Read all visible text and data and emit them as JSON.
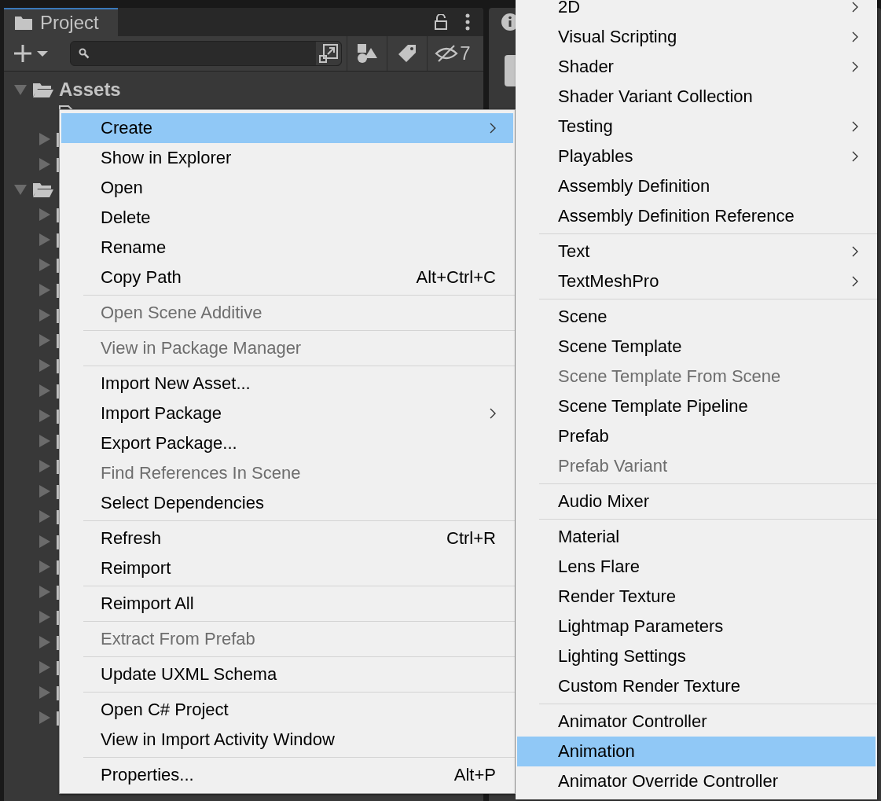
{
  "project_panel": {
    "tab": {
      "label": "Project",
      "selected": true
    },
    "hidden_count": "7",
    "tree": [
      {
        "label": "Assets",
        "kind": "folder",
        "expanded": true,
        "children": [
          {
            "kind": "file"
          },
          {
            "kind": "folder",
            "expanded": false
          },
          {
            "kind": "folder",
            "expanded": false
          }
        ]
      },
      {
        "kind": "folder",
        "expanded": true,
        "children": [
          {
            "kind": "folder",
            "expanded": false
          },
          {
            "kind": "folder",
            "expanded": false
          },
          {
            "kind": "folder",
            "expanded": false
          },
          {
            "kind": "folder",
            "expanded": false
          },
          {
            "kind": "folder",
            "expanded": false
          },
          {
            "kind": "folder",
            "expanded": false
          },
          {
            "kind": "folder",
            "expanded": false
          },
          {
            "kind": "folder",
            "expanded": false
          },
          {
            "kind": "folder",
            "expanded": false
          },
          {
            "kind": "folder",
            "expanded": false
          },
          {
            "kind": "folder",
            "expanded": false
          },
          {
            "kind": "folder",
            "expanded": false
          },
          {
            "kind": "folder",
            "expanded": false
          },
          {
            "kind": "folder",
            "expanded": false
          },
          {
            "kind": "folder",
            "expanded": false
          },
          {
            "kind": "folder",
            "expanded": false
          },
          {
            "kind": "folder",
            "expanded": false
          },
          {
            "kind": "folder",
            "expanded": false
          },
          {
            "kind": "folder",
            "expanded": false
          },
          {
            "kind": "folder",
            "expanded": false
          },
          {
            "kind": "folder",
            "expanded": false
          }
        ]
      }
    ]
  },
  "context_menu": [
    {
      "kind": "item",
      "label": "Create",
      "submenu": true,
      "selected": true,
      "disabled": false
    },
    {
      "kind": "item",
      "label": "Show in Explorer",
      "selected": false,
      "disabled": false
    },
    {
      "kind": "item",
      "label": "Open",
      "selected": false,
      "disabled": false
    },
    {
      "kind": "item",
      "label": "Delete",
      "selected": false,
      "disabled": false
    },
    {
      "kind": "item",
      "label": "Rename",
      "selected": false,
      "disabled": false
    },
    {
      "kind": "item",
      "label": "Copy Path",
      "shortcut": "Alt+Ctrl+C",
      "selected": false,
      "disabled": false
    },
    {
      "kind": "separator"
    },
    {
      "kind": "item",
      "label": "Open Scene Additive",
      "selected": false,
      "disabled": true
    },
    {
      "kind": "separator"
    },
    {
      "kind": "item",
      "label": "View in Package Manager",
      "selected": false,
      "disabled": true
    },
    {
      "kind": "separator"
    },
    {
      "kind": "item",
      "label": "Import New Asset...",
      "selected": false,
      "disabled": false
    },
    {
      "kind": "item",
      "label": "Import Package",
      "submenu": true,
      "selected": false,
      "disabled": false
    },
    {
      "kind": "item",
      "label": "Export Package...",
      "selected": false,
      "disabled": false
    },
    {
      "kind": "item",
      "label": "Find References In Scene",
      "selected": false,
      "disabled": true
    },
    {
      "kind": "item",
      "label": "Select Dependencies",
      "selected": false,
      "disabled": false
    },
    {
      "kind": "separator"
    },
    {
      "kind": "item",
      "label": "Refresh",
      "shortcut": "Ctrl+R",
      "selected": false,
      "disabled": false
    },
    {
      "kind": "item",
      "label": "Reimport",
      "selected": false,
      "disabled": false
    },
    {
      "kind": "separator"
    },
    {
      "kind": "item",
      "label": "Reimport All",
      "selected": false,
      "disabled": false
    },
    {
      "kind": "separator"
    },
    {
      "kind": "item",
      "label": "Extract From Prefab",
      "selected": false,
      "disabled": true
    },
    {
      "kind": "separator"
    },
    {
      "kind": "item",
      "label": "Update UXML Schema",
      "selected": false,
      "disabled": false
    },
    {
      "kind": "separator"
    },
    {
      "kind": "item",
      "label": "Open C# Project",
      "selected": false,
      "disabled": false
    },
    {
      "kind": "item",
      "label": "View in Import Activity Window",
      "selected": false,
      "disabled": false
    },
    {
      "kind": "separator"
    },
    {
      "kind": "item",
      "label": "Properties...",
      "shortcut": "Alt+P",
      "selected": false,
      "disabled": false
    }
  ],
  "create_submenu": [
    {
      "kind": "item",
      "label": "2D",
      "submenu": true,
      "selected": false,
      "disabled": false
    },
    {
      "kind": "item",
      "label": "Visual Scripting",
      "submenu": true,
      "selected": false,
      "disabled": false
    },
    {
      "kind": "item",
      "label": "Shader",
      "submenu": true,
      "selected": false,
      "disabled": false
    },
    {
      "kind": "item",
      "label": "Shader Variant Collection",
      "selected": false,
      "disabled": false
    },
    {
      "kind": "item",
      "label": "Testing",
      "submenu": true,
      "selected": false,
      "disabled": false
    },
    {
      "kind": "item",
      "label": "Playables",
      "submenu": true,
      "selected": false,
      "disabled": false
    },
    {
      "kind": "item",
      "label": "Assembly Definition",
      "selected": false,
      "disabled": false
    },
    {
      "kind": "item",
      "label": "Assembly Definition Reference",
      "selected": false,
      "disabled": false
    },
    {
      "kind": "separator"
    },
    {
      "kind": "item",
      "label": "Text",
      "submenu": true,
      "selected": false,
      "disabled": false
    },
    {
      "kind": "item",
      "label": "TextMeshPro",
      "submenu": true,
      "selected": false,
      "disabled": false
    },
    {
      "kind": "separator"
    },
    {
      "kind": "item",
      "label": "Scene",
      "selected": false,
      "disabled": false
    },
    {
      "kind": "item",
      "label": "Scene Template",
      "selected": false,
      "disabled": false
    },
    {
      "kind": "item",
      "label": "Scene Template From Scene",
      "selected": false,
      "disabled": true
    },
    {
      "kind": "item",
      "label": "Scene Template Pipeline",
      "selected": false,
      "disabled": false
    },
    {
      "kind": "item",
      "label": "Prefab",
      "selected": false,
      "disabled": false
    },
    {
      "kind": "item",
      "label": "Prefab Variant",
      "selected": false,
      "disabled": true
    },
    {
      "kind": "separator"
    },
    {
      "kind": "item",
      "label": "Audio Mixer",
      "selected": false,
      "disabled": false
    },
    {
      "kind": "separator"
    },
    {
      "kind": "item",
      "label": "Material",
      "selected": false,
      "disabled": false
    },
    {
      "kind": "item",
      "label": "Lens Flare",
      "selected": false,
      "disabled": false
    },
    {
      "kind": "item",
      "label": "Render Texture",
      "selected": false,
      "disabled": false
    },
    {
      "kind": "item",
      "label": "Lightmap Parameters",
      "selected": false,
      "disabled": false
    },
    {
      "kind": "item",
      "label": "Lighting Settings",
      "selected": false,
      "disabled": false
    },
    {
      "kind": "item",
      "label": "Custom Render Texture",
      "selected": false,
      "disabled": false
    },
    {
      "kind": "separator"
    },
    {
      "kind": "item",
      "label": "Animator Controller",
      "selected": false,
      "disabled": false
    },
    {
      "kind": "item",
      "label": "Animation",
      "selected": true,
      "disabled": false
    },
    {
      "kind": "item",
      "label": "Animator Override Controller",
      "selected": false,
      "disabled": false
    }
  ]
}
